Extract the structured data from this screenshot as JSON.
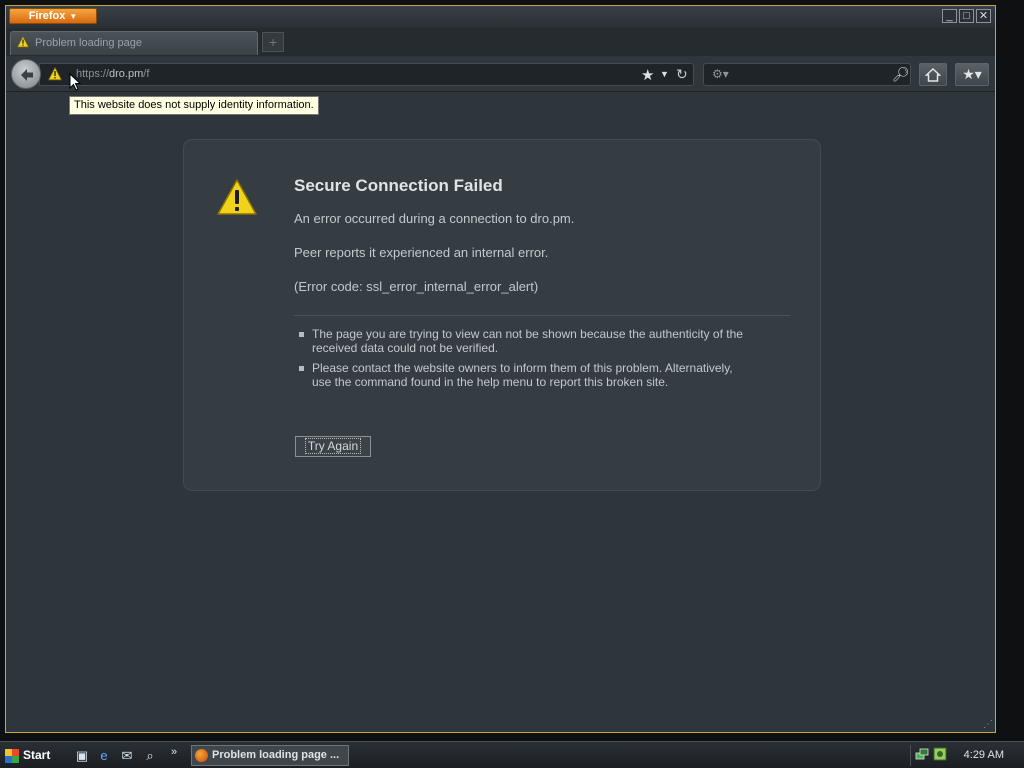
{
  "window": {
    "app_button": "Firefox",
    "controls": {
      "minimize": "_",
      "maximize": "□",
      "close": "✕"
    }
  },
  "tabs": [
    {
      "label": "Problem loading page",
      "active": true
    }
  ],
  "navbar": {
    "url_scheme": "https://",
    "url_host": "dro.pm",
    "url_path": "/f",
    "tooltip": "This website does not supply identity information."
  },
  "error": {
    "title": "Secure Connection Failed",
    "line1": "An error occurred during a connection to dro.pm.",
    "line2": "Peer reports it experienced an internal error.",
    "line3": "(Error code: ssl_error_internal_error_alert)",
    "bullets": [
      "The page you are trying to view can not be shown because the authenticity of the received data could not be verified.",
      "Please contact the website owners to inform them of this problem. Alternatively, use the command found in the help menu to report this broken site."
    ],
    "try_again": "Try Again"
  },
  "taskbar": {
    "start_label": "Start",
    "task_label": "Problem loading page ...",
    "clock": "4:29 AM"
  },
  "colors": {
    "accent": "#d86a10",
    "window_border": "#c4a83c",
    "page_bg": "#2e353b",
    "warning_yellow": "#f2d31b"
  }
}
